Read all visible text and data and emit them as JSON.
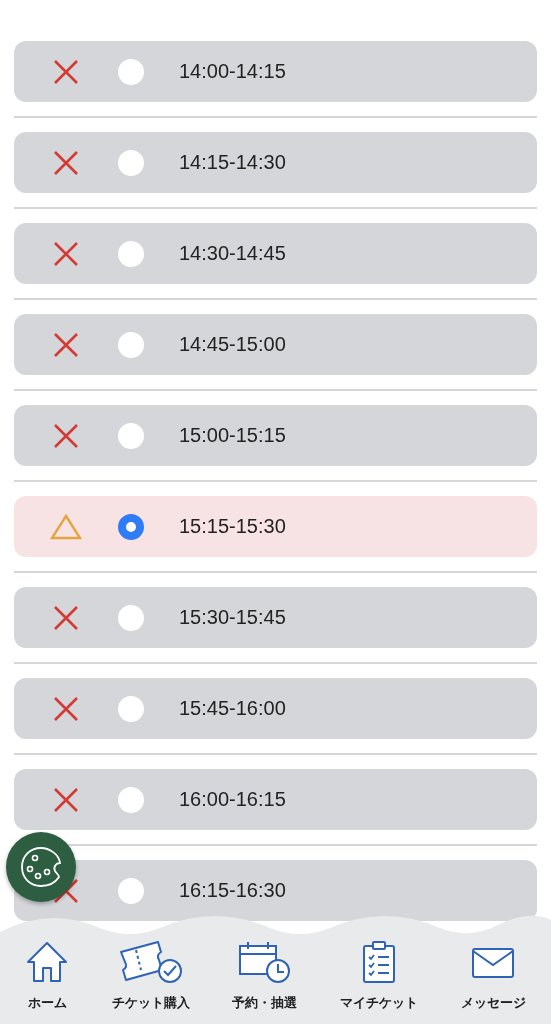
{
  "slots": [
    {
      "kind": "unavailable",
      "selected": false,
      "time": "14:00-14:15"
    },
    {
      "kind": "unavailable",
      "selected": false,
      "time": "14:15-14:30"
    },
    {
      "kind": "unavailable",
      "selected": false,
      "time": "14:30-14:45"
    },
    {
      "kind": "unavailable",
      "selected": false,
      "time": "14:45-15:00"
    },
    {
      "kind": "unavailable",
      "selected": false,
      "time": "15:00-15:15"
    },
    {
      "kind": "few",
      "selected": true,
      "time": "15:15-15:30"
    },
    {
      "kind": "unavailable",
      "selected": false,
      "time": "15:30-15:45"
    },
    {
      "kind": "unavailable",
      "selected": false,
      "time": "15:45-16:00"
    },
    {
      "kind": "unavailable",
      "selected": false,
      "time": "16:00-16:15"
    },
    {
      "kind": "unavailable",
      "selected": false,
      "time": "16:15-16:30"
    }
  ],
  "nav": [
    {
      "kind": "home",
      "label": "ホーム"
    },
    {
      "kind": "ticket",
      "label": "チケット購入"
    },
    {
      "kind": "calendar",
      "label": "予約・抽選"
    },
    {
      "kind": "clipboard",
      "label": "マイチケット"
    },
    {
      "kind": "mail",
      "label": "メッセージ"
    }
  ]
}
